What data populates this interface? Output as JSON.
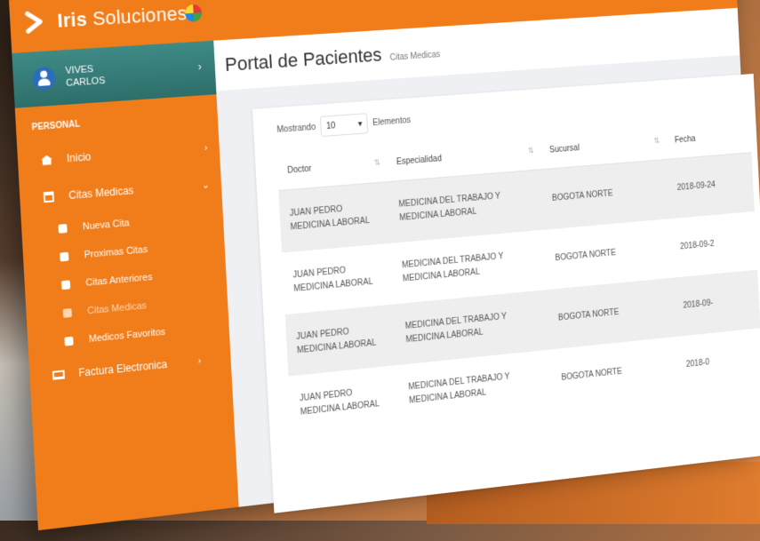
{
  "app": {
    "brand_prefix": "Iris",
    "brand_suffix": " Soluciones"
  },
  "user": {
    "name_line1": "VIVES",
    "name_line2": "CARLOS"
  },
  "sidebar": {
    "section_label": "PERSONAL",
    "items": [
      {
        "label": "Inicio",
        "icon": "home-icon"
      },
      {
        "label": "Citas Medicas",
        "icon": "calendar-icon"
      },
      {
        "label": "Factura Electronica",
        "icon": "laptop-icon"
      }
    ],
    "sub_items": [
      {
        "label": "Nueva Cita"
      },
      {
        "label": "Proximas Citas"
      },
      {
        "label": "Citas Anteriores"
      },
      {
        "label": "Citas Medicas"
      },
      {
        "label": "Medicos Favoritos"
      }
    ]
  },
  "header": {
    "title": "Portal de Pacientes",
    "subtitle": "Citas Medicas"
  },
  "table_controls": {
    "showing_label": "Mostrando",
    "page_size": "10",
    "elements_label": "Elementos"
  },
  "table": {
    "columns": [
      "Doctor",
      "Especialidad",
      "Sucursal",
      "Fecha"
    ],
    "rows": [
      {
        "doctor": "JUAN PEDRO MEDICINA LABORAL",
        "especialidad": "MEDICINA DEL TRABAJO Y MEDICINA LABORAL",
        "sucursal": "BOGOTA NORTE",
        "fecha": "2018-09-24"
      },
      {
        "doctor": "JUAN PEDRO MEDICINA LABORAL",
        "especialidad": "MEDICINA DEL TRABAJO Y MEDICINA LABORAL",
        "sucursal": "BOGOTA NORTE",
        "fecha": "2018-09-2"
      },
      {
        "doctor": "JUAN PEDRO MEDICINA LABORAL",
        "especialidad": "MEDICINA DEL TRABAJO Y MEDICINA LABORAL",
        "sucursal": "BOGOTA NORTE",
        "fecha": "2018-09-"
      },
      {
        "doctor": "JUAN PEDRO MEDICINA LABORAL",
        "especialidad": "MEDICINA DEL TRABAJO Y MEDICINA LABORAL",
        "sucursal": "BOGOTA NORTE",
        "fecha": "2018-0"
      }
    ]
  },
  "colors": {
    "accent": "#f07d1a",
    "user_panel": "#3f8a86"
  }
}
